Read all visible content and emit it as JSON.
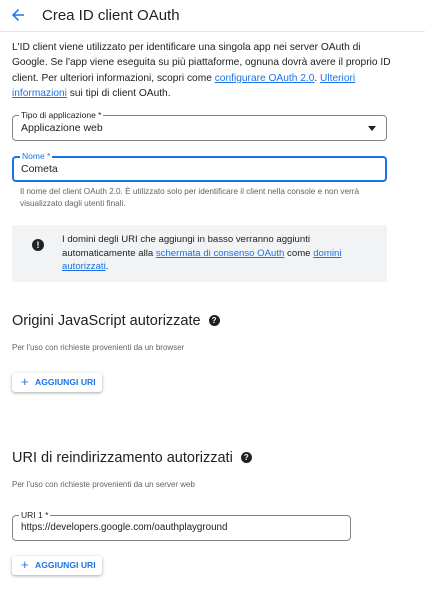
{
  "header": {
    "title": "Crea ID client OAuth"
  },
  "intro": {
    "text_1": "L'ID client viene utilizzato per identificare una singola app nei server OAuth di Google. Se l'app viene eseguita su più piattaforme, ognuna dovrà avere il proprio ID client. Per ulteriori informazioni, scopri come ",
    "link_1": "configurare OAuth 2.0",
    "text_2": ". ",
    "link_2": "Ulteriori informazioni",
    "text_3": " sui tipi di client OAuth."
  },
  "app_type": {
    "label": "Tipo di applicazione *",
    "value": "Applicazione web"
  },
  "name_field": {
    "label": "Nome *",
    "value": "Cometa",
    "hint": "Il nome del client OAuth 2.0. È utilizzato solo per identificare il client nella console e non verrà visualizzato dagli utenti finali."
  },
  "info_box": {
    "text_1": "I domini degli URI che aggiungi in basso verranno aggiunti automaticamente alla ",
    "link_1": "schermata di consenso OAuth",
    "text_2": " come ",
    "link_2": "domini autorizzati",
    "text_3": "."
  },
  "js_origins": {
    "title": "Origini JavaScript autorizzate",
    "subtitle": "Per l'uso con richieste provenienti da un browser",
    "add_label": "AGGIUNGI URI"
  },
  "redirect_uris": {
    "title": "URI di reindirizzamento autorizzati",
    "subtitle": "Per l'uso con richieste provenienti da un server web",
    "uri_label": "URI 1 *",
    "uri_value": "https://developers.google.com/oauthplayground",
    "add_label": "AGGIUNGI URI"
  },
  "colors": {
    "accent": "#1a73e8",
    "text": "#202124",
    "secondary_text": "#5f6368",
    "info_background": "#f1f3f4"
  },
  "icons": {
    "back": "arrow-back-icon",
    "info": "info-icon",
    "help": "help-icon",
    "dropdown": "dropdown-caret-icon",
    "add": "plus-icon"
  }
}
